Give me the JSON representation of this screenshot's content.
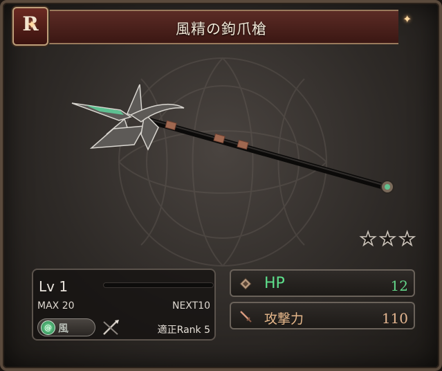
{
  "header": {
    "title": "風精の鉤爪槍",
    "rarity_letter": "R"
  },
  "weapon": {
    "icon": "spear-weapon-art",
    "rarity_stars": 3
  },
  "level_panel": {
    "level_label": "Lv 1",
    "max_label": "MAX 20",
    "next_label": "NEXT10",
    "exp_fraction": 0,
    "element_label": "風",
    "element_icon": "wind-element-icon",
    "weapon_type_icon": "spear-type-icon",
    "rank_label": "適正Rank 5"
  },
  "stats": {
    "hp": {
      "label": "HP",
      "value": "12"
    },
    "attack": {
      "label": "攻撃力",
      "value": "110"
    }
  },
  "colors": {
    "hp_green": "#5ee08c",
    "attack_tan": "#e7b88b",
    "title_bar": "#4b211c"
  }
}
